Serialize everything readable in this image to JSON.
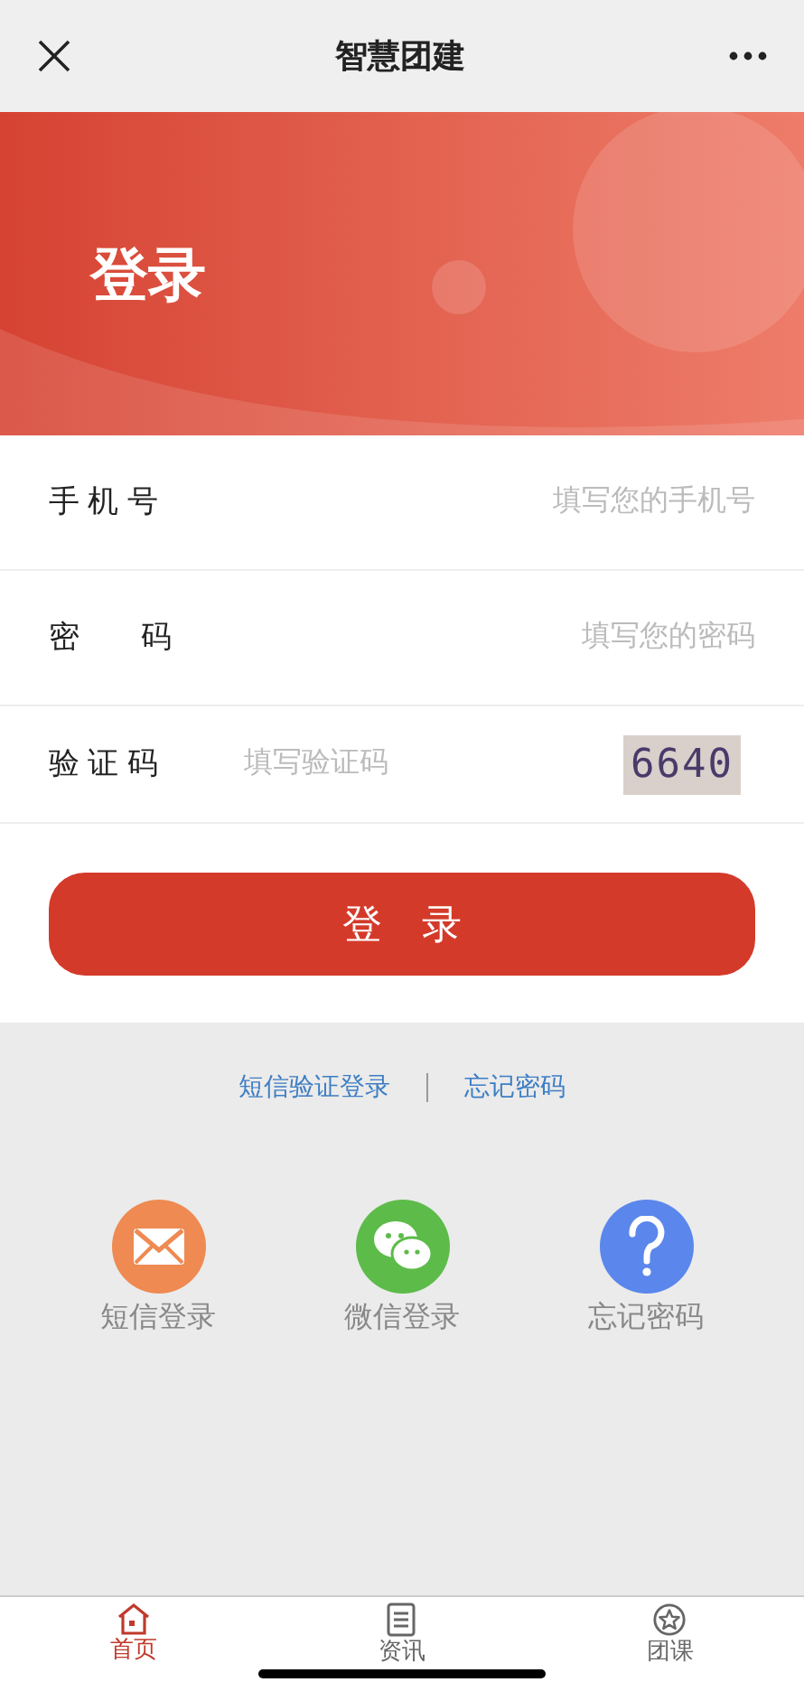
{
  "nav_bar": {
    "title": "智慧团建"
  },
  "banner": {
    "title": "登录"
  },
  "form": {
    "fields": [
      {
        "kind": "text",
        "label": "手 机 号",
        "placeholder": "填写您的手机号"
      },
      {
        "kind": "text",
        "label": "密　　码",
        "placeholder": "填写您的密码"
      },
      {
        "kind": "captcha",
        "label": "验 证 码",
        "placeholder": "填写验证码",
        "captcha": "6640"
      }
    ],
    "submit": "登　录"
  },
  "links": [
    "短信验证登录",
    "忘记密码"
  ],
  "quick_logins": [
    {
      "kind": "mail",
      "label": "短信登录",
      "color": "#ee8a52"
    },
    {
      "kind": "chat",
      "label": "微信登录",
      "color": "#5dbb4a"
    },
    {
      "kind": "help",
      "label": "忘记密码",
      "color": "#5b86ec"
    }
  ],
  "tab_bar": [
    {
      "kind": "home",
      "label": "首页",
      "selected": true
    },
    {
      "kind": "news",
      "label": "资讯",
      "selected": false
    },
    {
      "kind": "star",
      "label": "团课",
      "selected": false
    }
  ]
}
